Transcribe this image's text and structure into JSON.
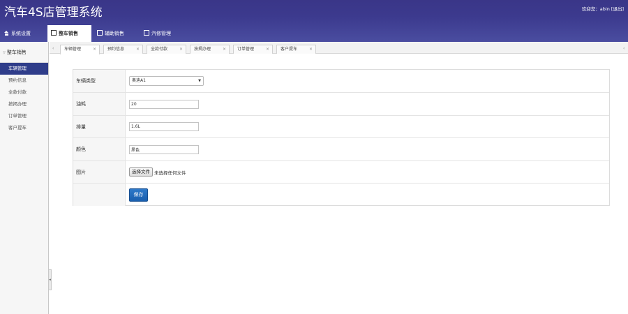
{
  "app": {
    "title": "汽车4S店管理系统"
  },
  "user": {
    "greeting": "欢迎您：abin",
    "logout": "[退出]"
  },
  "topnav": {
    "items": [
      {
        "label": "系统设置",
        "icon": "home-icon"
      },
      {
        "label": "整车销售",
        "icon": "document-icon"
      },
      {
        "label": "辅助销售",
        "icon": "document-icon"
      },
      {
        "label": "汽修管理",
        "icon": "document-icon"
      }
    ],
    "active_index": 1
  },
  "sidebar": {
    "title": "整车销售",
    "items": [
      {
        "label": "车辆管理"
      },
      {
        "label": "预约信息"
      },
      {
        "label": "全款付款"
      },
      {
        "label": "按揭办理"
      },
      {
        "label": "订单管理"
      },
      {
        "label": "客户提车"
      }
    ],
    "active_index": 0
  },
  "tabs": {
    "items": [
      {
        "label": "车辆管理",
        "close": "×"
      },
      {
        "label": "预约信息",
        "close": "×"
      },
      {
        "label": "全款付款",
        "close": "×"
      },
      {
        "label": "按揭办理",
        "close": "×"
      },
      {
        "label": "订单管理",
        "close": "×"
      },
      {
        "label": "客户提车",
        "close": "×"
      }
    ],
    "active_index": 0
  },
  "form": {
    "vehicle_type": {
      "label": "车辆类型",
      "value": "奥迪A1"
    },
    "fuel": {
      "label": "油耗",
      "value": "20"
    },
    "displacement": {
      "label": "排量",
      "value": "1.6L"
    },
    "color": {
      "label": "颜色",
      "value": "黑色"
    },
    "image": {
      "label": "图片",
      "button": "选择文件",
      "status": "未选择任何文件"
    },
    "save": {
      "label": "保存"
    }
  },
  "colors": {
    "header": "#3a3688",
    "sidebar_active": "#2f3d8a",
    "save_button": "#1f66b8"
  }
}
